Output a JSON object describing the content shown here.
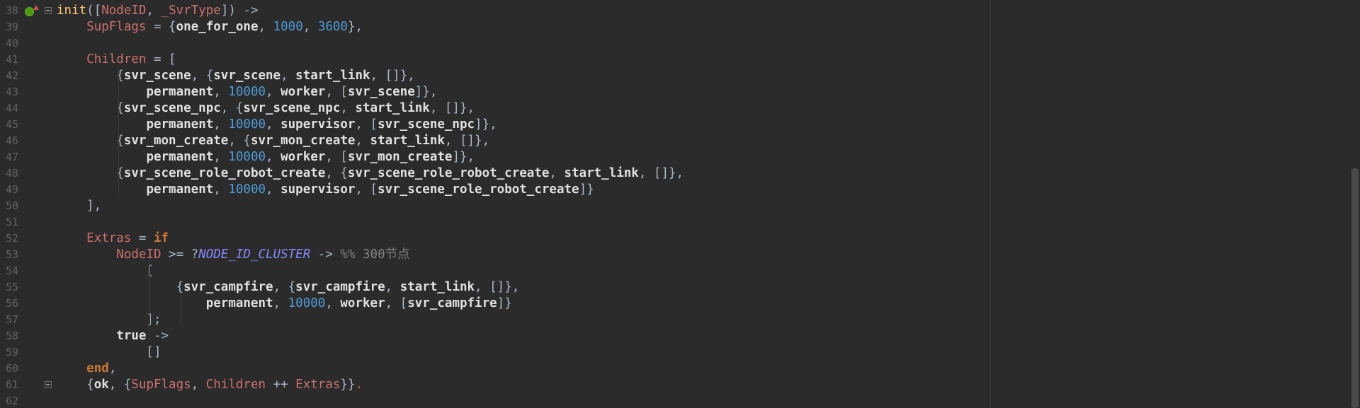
{
  "editor": {
    "lines": [
      {
        "num": "38",
        "tokens": [
          {
            "t": "init",
            "c": "f"
          },
          {
            "t": "([",
            "c": "p"
          },
          {
            "t": "NodeID",
            "c": "v"
          },
          {
            "t": ", ",
            "c": "p"
          },
          {
            "t": "_SvrType",
            "c": "vi"
          },
          {
            "t": "]) ->",
            "c": "p"
          }
        ]
      },
      {
        "num": "39",
        "tokens": [
          {
            "t": "    ",
            "c": "p"
          },
          {
            "t": "SupFlags",
            "c": "v"
          },
          {
            "t": " = {",
            "c": "p"
          },
          {
            "t": "one_for_one",
            "c": "a"
          },
          {
            "t": ", ",
            "c": "p"
          },
          {
            "t": "1000",
            "c": "n"
          },
          {
            "t": ", ",
            "c": "p"
          },
          {
            "t": "3600",
            "c": "n"
          },
          {
            "t": "},",
            "c": "p"
          }
        ]
      },
      {
        "num": "40",
        "tokens": []
      },
      {
        "num": "41",
        "tokens": [
          {
            "t": "    ",
            "c": "p"
          },
          {
            "t": "Children",
            "c": "v"
          },
          {
            "t": " = [",
            "c": "p"
          }
        ]
      },
      {
        "num": "42",
        "tokens": [
          {
            "t": "        {",
            "c": "p"
          },
          {
            "t": "svr_scene",
            "c": "a"
          },
          {
            "t": ", {",
            "c": "p"
          },
          {
            "t": "svr_scene",
            "c": "a"
          },
          {
            "t": ", ",
            "c": "p"
          },
          {
            "t": "start_link",
            "c": "a"
          },
          {
            "t": ", []},",
            "c": "p"
          }
        ]
      },
      {
        "num": "43",
        "tokens": [
          {
            "t": "            ",
            "c": "p"
          },
          {
            "t": "permanent",
            "c": "a"
          },
          {
            "t": ", ",
            "c": "p"
          },
          {
            "t": "10000",
            "c": "n"
          },
          {
            "t": ", ",
            "c": "p"
          },
          {
            "t": "worker",
            "c": "a"
          },
          {
            "t": ", [",
            "c": "p"
          },
          {
            "t": "svr_scene",
            "c": "a"
          },
          {
            "t": "]},",
            "c": "p"
          }
        ]
      },
      {
        "num": "44",
        "tokens": [
          {
            "t": "        {",
            "c": "p"
          },
          {
            "t": "svr_scene_npc",
            "c": "a"
          },
          {
            "t": ", {",
            "c": "p"
          },
          {
            "t": "svr_scene_npc",
            "c": "a"
          },
          {
            "t": ", ",
            "c": "p"
          },
          {
            "t": "start_link",
            "c": "a"
          },
          {
            "t": ", []},",
            "c": "p"
          }
        ]
      },
      {
        "num": "45",
        "tokens": [
          {
            "t": "            ",
            "c": "p"
          },
          {
            "t": "permanent",
            "c": "a"
          },
          {
            "t": ", ",
            "c": "p"
          },
          {
            "t": "10000",
            "c": "n"
          },
          {
            "t": ", ",
            "c": "p"
          },
          {
            "t": "supervisor",
            "c": "a"
          },
          {
            "t": ", [",
            "c": "p"
          },
          {
            "t": "svr_scene_npc",
            "c": "a"
          },
          {
            "t": "]},",
            "c": "p"
          }
        ]
      },
      {
        "num": "46",
        "tokens": [
          {
            "t": "        {",
            "c": "p"
          },
          {
            "t": "svr_mon_create",
            "c": "a"
          },
          {
            "t": ", {",
            "c": "p"
          },
          {
            "t": "svr_mon_create",
            "c": "a"
          },
          {
            "t": ", ",
            "c": "p"
          },
          {
            "t": "start_link",
            "c": "a"
          },
          {
            "t": ", []},",
            "c": "p"
          }
        ]
      },
      {
        "num": "47",
        "tokens": [
          {
            "t": "            ",
            "c": "p"
          },
          {
            "t": "permanent",
            "c": "a"
          },
          {
            "t": ", ",
            "c": "p"
          },
          {
            "t": "10000",
            "c": "n"
          },
          {
            "t": ", ",
            "c": "p"
          },
          {
            "t": "worker",
            "c": "a"
          },
          {
            "t": ", [",
            "c": "p"
          },
          {
            "t": "svr_mon_create",
            "c": "a"
          },
          {
            "t": "]},",
            "c": "p"
          }
        ]
      },
      {
        "num": "48",
        "tokens": [
          {
            "t": "        {",
            "c": "p"
          },
          {
            "t": "svr_scene_role_robot_create",
            "c": "a"
          },
          {
            "t": ", {",
            "c": "p"
          },
          {
            "t": "svr_scene_role_robot_create",
            "c": "a"
          },
          {
            "t": ", ",
            "c": "p"
          },
          {
            "t": "start_link",
            "c": "a"
          },
          {
            "t": ", []},",
            "c": "p"
          }
        ]
      },
      {
        "num": "49",
        "tokens": [
          {
            "t": "            ",
            "c": "p"
          },
          {
            "t": "permanent",
            "c": "a"
          },
          {
            "t": ", ",
            "c": "p"
          },
          {
            "t": "10000",
            "c": "n"
          },
          {
            "t": ", ",
            "c": "p"
          },
          {
            "t": "supervisor",
            "c": "a"
          },
          {
            "t": ", [",
            "c": "p"
          },
          {
            "t": "svr_scene_role_robot_create",
            "c": "a"
          },
          {
            "t": "]}",
            "c": "p"
          }
        ]
      },
      {
        "num": "50",
        "tokens": [
          {
            "t": "    ],",
            "c": "p"
          }
        ]
      },
      {
        "num": "51",
        "tokens": []
      },
      {
        "num": "52",
        "tokens": [
          {
            "t": "    ",
            "c": "p"
          },
          {
            "t": "Extras",
            "c": "v"
          },
          {
            "t": " = ",
            "c": "p"
          },
          {
            "t": "if",
            "c": "k"
          }
        ]
      },
      {
        "num": "53",
        "tokens": [
          {
            "t": "        ",
            "c": "p"
          },
          {
            "t": "NodeID",
            "c": "v"
          },
          {
            "t": " >= ?",
            "c": "p"
          },
          {
            "t": "NODE_ID_CLUSTER",
            "c": "m"
          },
          {
            "t": " -> ",
            "c": "p"
          },
          {
            "t": "%% 300节点",
            "c": "c"
          }
        ]
      },
      {
        "num": "54",
        "tokens": [
          {
            "t": "            [",
            "c": "p"
          }
        ]
      },
      {
        "num": "55",
        "tokens": [
          {
            "t": "                {",
            "c": "p"
          },
          {
            "t": "svr_campfire",
            "c": "a"
          },
          {
            "t": ", {",
            "c": "p"
          },
          {
            "t": "svr_campfire",
            "c": "a"
          },
          {
            "t": ", ",
            "c": "p"
          },
          {
            "t": "start_link",
            "c": "a"
          },
          {
            "t": ", []},",
            "c": "p"
          }
        ]
      },
      {
        "num": "56",
        "tokens": [
          {
            "t": "                    ",
            "c": "p"
          },
          {
            "t": "permanent",
            "c": "a"
          },
          {
            "t": ", ",
            "c": "p"
          },
          {
            "t": "10000",
            "c": "n"
          },
          {
            "t": ", ",
            "c": "p"
          },
          {
            "t": "worker",
            "c": "a"
          },
          {
            "t": ", [",
            "c": "p"
          },
          {
            "t": "svr_campfire",
            "c": "a"
          },
          {
            "t": "]}",
            "c": "p"
          }
        ]
      },
      {
        "num": "57",
        "tokens": [
          {
            "t": "            ];",
            "c": "p"
          }
        ]
      },
      {
        "num": "58",
        "tokens": [
          {
            "t": "        ",
            "c": "p"
          },
          {
            "t": "true",
            "c": "a"
          },
          {
            "t": " ->",
            "c": "p"
          }
        ]
      },
      {
        "num": "59",
        "tokens": [
          {
            "t": "            []",
            "c": "p"
          }
        ]
      },
      {
        "num": "60",
        "tokens": [
          {
            "t": "    ",
            "c": "p"
          },
          {
            "t": "end",
            "c": "k"
          },
          {
            "t": ",",
            "c": "p"
          }
        ]
      },
      {
        "num": "61",
        "tokens": [
          {
            "t": "    {",
            "c": "p"
          },
          {
            "t": "ok",
            "c": "a"
          },
          {
            "t": ", {",
            "c": "p"
          },
          {
            "t": "SupFlags",
            "c": "v"
          },
          {
            "t": ", ",
            "c": "p"
          },
          {
            "t": "Children",
            "c": "v"
          },
          {
            "t": " ++ ",
            "c": "p"
          },
          {
            "t": "Extras",
            "c": "v"
          },
          {
            "t": "}}",
            "c": "p"
          },
          {
            "t": ".",
            "c": "dot"
          }
        ]
      },
      {
        "num": "62",
        "tokens": []
      }
    ]
  },
  "colors": {
    "background": "#2b2b2b",
    "variable": "#cc7070",
    "atom": "#e0e0e0",
    "number": "#4f9ad6",
    "keyword": "#cc7832",
    "macro": "#8888ff",
    "comment": "#808080",
    "function": "#ffc66d"
  },
  "icons": {
    "line38_marker": "implements-icon",
    "fold_marker": "fold-icon"
  }
}
